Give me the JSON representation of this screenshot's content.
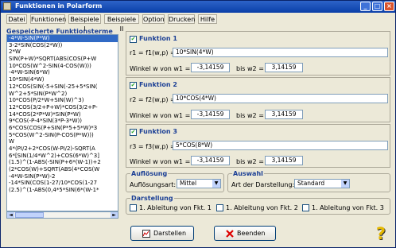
{
  "window": {
    "title": "Funktionen in Polarform",
    "min": "_",
    "max": "□",
    "close": "×"
  },
  "menu": [
    {
      "label": "Datei"
    },
    {
      "label": "Funktionen"
    },
    {
      "label": "Beispiele I"
    },
    {
      "label": "Beispiele II"
    },
    {
      "label": "Option"
    },
    {
      "label": "Drucken"
    },
    {
      "label": "Hilfe"
    }
  ],
  "list": {
    "header": "Gespeicherte Funktionsterme",
    "items": [
      "-4*W-SIN(P*W)",
      "3-2*SIN(COS(2*W))",
      "2*W",
      "SIN(P+W)*SQRT(ABS(COS(P+W",
      "10*COS(W^2-SIN(4-COS(W)))",
      "-4*W-SIN(6*W)",
      "10*SIN(4*W)",
      "12*COS(SIN(-5+SIN(-25+5*SIN(",
      "W^2+5*SIN(P*W^2)",
      "10*COS(P/2*W+SIN(W)^3)",
      "12*COS(3/2+P+W)*COS(3/2+P-",
      "14*COS(2*P*W)*SIN(P*W)",
      "9*COS(-P-4*SIN(3*P-3*W))",
      "6*COS(COS(P+SIN(P*5+5*W)*3",
      "5*COS(W^2-SIN(P-COS(P*W)))",
      "W",
      "4*(PI/2+2*COS(W-PI/2)-SQRT(A",
      "6*[SIN(1/4*W^2)+COS(6*W)^3]",
      "(1.5)^(1-ABS(-SIN(P+6*(W-1))+2",
      "(2*COS(W)+SQRT(ABS(4*COS(W",
      "-4*W-SIN(P*W)-2",
      "-14*SIN(COS(1-27/10*COS(1-27",
      "(2.5)^(1-ABS(0,4*5*SIN(6*(W-1*"
    ]
  },
  "functions": [
    {
      "title": "Funktion 1",
      "label": "r1 = f1(w,p) =",
      "expr": "10*SIN(4*W)",
      "winkel": "Winkel w von w1 =",
      "w1": "-3,14159",
      "bis": "bis w2 =",
      "w2": "3,14159"
    },
    {
      "title": "Funktion 2",
      "label": "r2 = f2(w,p) =",
      "expr": "10*COS(4*W)",
      "winkel": "Winkel w von w1 =",
      "w1": "-3,14159",
      "bis": "bis w2 =",
      "w2": "3,14159"
    },
    {
      "title": "Funktion 3",
      "label": "r3 = f3(w,p) =",
      "expr": "5*COS(8*W)",
      "winkel": "Winkel w von w1 =",
      "w1": "-3,14159",
      "bis": "bis w2 =",
      "w2": "3,14159"
    }
  ],
  "aufloesung": {
    "title": "Auflösung",
    "label": "Auflösungsart:",
    "value": "Mittel"
  },
  "auswahl": {
    "title": "Auswahl",
    "label": "Art der Darstellung:",
    "value": "Standard"
  },
  "darstellung": {
    "title": "Darstellung",
    "items": [
      "1. Ableitung von Fkt. 1",
      "1. Ableitung von Fkt. 2",
      "1. Ableitung von Fkt. 3"
    ]
  },
  "buttons": {
    "darstellen": "Darstellen",
    "beenden": "Beenden",
    "help": "?"
  },
  "colors": {
    "title_bar": "#0a3fa8",
    "selection": "#316ac5",
    "group_title": "#1b3f95",
    "check": "#21a121",
    "close": "#d9542e"
  }
}
